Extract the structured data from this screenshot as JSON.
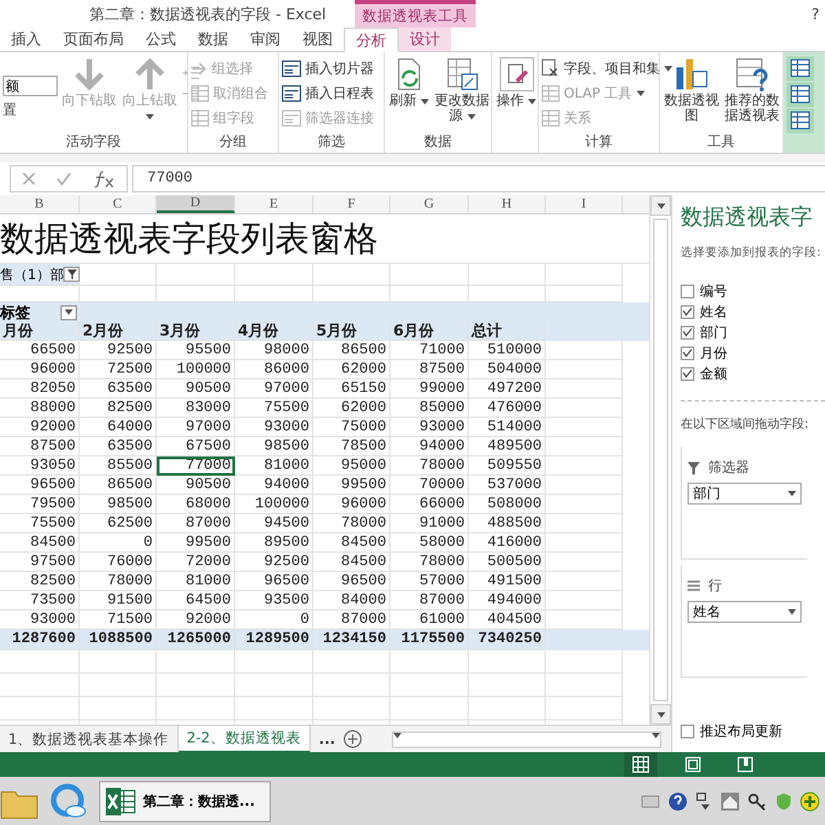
{
  "title_bar": {
    "title": "第二章：数据透视表的字段 - Excel",
    "context_tab": "数据透视表工具",
    "help": "?"
  },
  "tabs": [
    {
      "label": "插入",
      "selected": false,
      "contextual": false
    },
    {
      "label": "页面布局",
      "selected": false,
      "contextual": false
    },
    {
      "label": "公式",
      "selected": false,
      "contextual": false
    },
    {
      "label": "数据",
      "selected": false,
      "contextual": false
    },
    {
      "label": "审阅",
      "selected": false,
      "contextual": false
    },
    {
      "label": "视图",
      "selected": false,
      "contextual": false
    },
    {
      "label": "分析",
      "selected": true,
      "contextual": true
    },
    {
      "label": "设计",
      "selected": false,
      "contextual": true
    }
  ],
  "ribbon": {
    "groups": [
      {
        "label": "活动字段",
        "items": [
          {
            "kind": "field",
            "value": "额"
          },
          {
            "kind": "text",
            "label": "置"
          },
          {
            "kind": "large",
            "label": "向下钻取",
            "disabled": true,
            "dropdown": false
          },
          {
            "kind": "large",
            "label": "向上钻取",
            "disabled": true,
            "dropdown": true
          },
          {
            "kind": "iconpair",
            "disabled": true
          }
        ]
      },
      {
        "label": "分组",
        "items": [
          {
            "kind": "small",
            "label": "组选择",
            "disabled": true,
            "dropdown": false
          },
          {
            "kind": "small",
            "label": "取消组合",
            "disabled": true,
            "dropdown": false
          },
          {
            "kind": "small",
            "label": "组字段",
            "disabled": true,
            "dropdown": false
          }
        ]
      },
      {
        "label": "筛选",
        "items": [
          {
            "kind": "small",
            "label": "插入切片器",
            "disabled": false,
            "dropdown": false
          },
          {
            "kind": "small",
            "label": "插入日程表",
            "disabled": false,
            "dropdown": false
          },
          {
            "kind": "small",
            "label": "筛选器连接",
            "disabled": true,
            "dropdown": false
          }
        ]
      },
      {
        "label": "数据",
        "items": [
          {
            "kind": "large",
            "label": "刷新",
            "disabled": false,
            "dropdown": true
          },
          {
            "kind": "large",
            "label": "更改数据源",
            "disabled": false,
            "dropdown": true
          }
        ]
      },
      {
        "items": [
          {
            "kind": "large",
            "label": "操作",
            "disabled": false,
            "dropdown": true
          }
        ]
      },
      {
        "label": "计算",
        "items": [
          {
            "kind": "small",
            "label": "字段、项目和集",
            "disabled": false,
            "dropdown": true
          },
          {
            "kind": "small",
            "label": "OLAP 工具",
            "disabled": true,
            "dropdown": true
          },
          {
            "kind": "small",
            "label": "关系",
            "disabled": true,
            "dropdown": false
          }
        ]
      },
      {
        "label": "工具",
        "items": [
          {
            "kind": "large",
            "label": "数据透视图",
            "disabled": false,
            "dropdown": false
          },
          {
            "kind": "large",
            "label": "推荐的数据透视表",
            "disabled": false,
            "dropdown": false
          }
        ]
      },
      {
        "items": [
          {
            "kind": "toggle",
            "on": true
          },
          {
            "kind": "toggle",
            "on": true
          },
          {
            "kind": "toggle",
            "on": true
          }
        ]
      }
    ]
  },
  "formula_bar": {
    "value": "77000"
  },
  "columns": [
    {
      "label": "B",
      "selected": false
    },
    {
      "label": "C",
      "selected": false
    },
    {
      "label": "D",
      "selected": true
    },
    {
      "label": "E",
      "selected": false
    },
    {
      "label": "F",
      "selected": false
    },
    {
      "label": "G",
      "selected": false
    },
    {
      "label": "H",
      "selected": false
    },
    {
      "label": "I",
      "selected": false
    }
  ],
  "sheet": {
    "title": "数据透视表字段列表窗格",
    "filter": "售（1）部",
    "column_label": "标签",
    "header": [
      "月份",
      "2月份",
      "3月份",
      "4月份",
      "5月份",
      "6月份",
      "总计"
    ],
    "rows": [
      [
        {
          "v": "66500",
          "selected": false
        },
        {
          "v": "92500",
          "selected": false
        },
        {
          "v": "95500",
          "selected": false
        },
        {
          "v": "98000",
          "selected": false
        },
        {
          "v": "86500",
          "selected": false
        },
        {
          "v": "71000",
          "selected": false
        },
        {
          "v": "510000",
          "selected": false
        }
      ],
      [
        {
          "v": "96000",
          "selected": false
        },
        {
          "v": "72500",
          "selected": false
        },
        {
          "v": "100000",
          "selected": false
        },
        {
          "v": "86000",
          "selected": false
        },
        {
          "v": "62000",
          "selected": false
        },
        {
          "v": "87500",
          "selected": false
        },
        {
          "v": "504000",
          "selected": false
        }
      ],
      [
        {
          "v": "82050",
          "selected": false
        },
        {
          "v": "63500",
          "selected": false
        },
        {
          "v": "90500",
          "selected": false
        },
        {
          "v": "97000",
          "selected": false
        },
        {
          "v": "65150",
          "selected": false
        },
        {
          "v": "99000",
          "selected": false
        },
        {
          "v": "497200",
          "selected": false
        }
      ],
      [
        {
          "v": "88000",
          "selected": false
        },
        {
          "v": "82500",
          "selected": false
        },
        {
          "v": "83000",
          "selected": false
        },
        {
          "v": "75500",
          "selected": false
        },
        {
          "v": "62000",
          "selected": false
        },
        {
          "v": "85000",
          "selected": false
        },
        {
          "v": "476000",
          "selected": false
        }
      ],
      [
        {
          "v": "92000",
          "selected": false
        },
        {
          "v": "64000",
          "selected": false
        },
        {
          "v": "97000",
          "selected": false
        },
        {
          "v": "93000",
          "selected": false
        },
        {
          "v": "75000",
          "selected": false
        },
        {
          "v": "93000",
          "selected": false
        },
        {
          "v": "514000",
          "selected": false
        }
      ],
      [
        {
          "v": "87500",
          "selected": false
        },
        {
          "v": "63500",
          "selected": false
        },
        {
          "v": "67500",
          "selected": false
        },
        {
          "v": "98500",
          "selected": false
        },
        {
          "v": "78500",
          "selected": false
        },
        {
          "v": "94000",
          "selected": false
        },
        {
          "v": "489500",
          "selected": false
        }
      ],
      [
        {
          "v": "93050",
          "selected": false
        },
        {
          "v": "85500",
          "selected": false
        },
        {
          "v": "77000",
          "selected": true
        },
        {
          "v": "81000",
          "selected": false
        },
        {
          "v": "95000",
          "selected": false
        },
        {
          "v": "78000",
          "selected": false
        },
        {
          "v": "509550",
          "selected": false
        }
      ],
      [
        {
          "v": "96500",
          "selected": false
        },
        {
          "v": "86500",
          "selected": false
        },
        {
          "v": "90500",
          "selected": false
        },
        {
          "v": "94000",
          "selected": false
        },
        {
          "v": "99500",
          "selected": false
        },
        {
          "v": "70000",
          "selected": false
        },
        {
          "v": "537000",
          "selected": false
        }
      ],
      [
        {
          "v": "79500",
          "selected": false
        },
        {
          "v": "98500",
          "selected": false
        },
        {
          "v": "68000",
          "selected": false
        },
        {
          "v": "100000",
          "selected": false
        },
        {
          "v": "96000",
          "selected": false
        },
        {
          "v": "66000",
          "selected": false
        },
        {
          "v": "508000",
          "selected": false
        }
      ],
      [
        {
          "v": "75500",
          "selected": false
        },
        {
          "v": "62500",
          "selected": false
        },
        {
          "v": "87000",
          "selected": false
        },
        {
          "v": "94500",
          "selected": false
        },
        {
          "v": "78000",
          "selected": false
        },
        {
          "v": "91000",
          "selected": false
        },
        {
          "v": "488500",
          "selected": false
        }
      ],
      [
        {
          "v": "84500",
          "selected": false
        },
        {
          "v": "0",
          "selected": false
        },
        {
          "v": "99500",
          "selected": false
        },
        {
          "v": "89500",
          "selected": false
        },
        {
          "v": "84500",
          "selected": false
        },
        {
          "v": "58000",
          "selected": false
        },
        {
          "v": "416000",
          "selected": false
        }
      ],
      [
        {
          "v": "97500",
          "selected": false
        },
        {
          "v": "76000",
          "selected": false
        },
        {
          "v": "72000",
          "selected": false
        },
        {
          "v": "92500",
          "selected": false
        },
        {
          "v": "84500",
          "selected": false
        },
        {
          "v": "78000",
          "selected": false
        },
        {
          "v": "500500",
          "selected": false
        }
      ],
      [
        {
          "v": "82500",
          "selected": false
        },
        {
          "v": "78000",
          "selected": false
        },
        {
          "v": "81000",
          "selected": false
        },
        {
          "v": "96500",
          "selected": false
        },
        {
          "v": "96500",
          "selected": false
        },
        {
          "v": "57000",
          "selected": false
        },
        {
          "v": "491500",
          "selected": false
        }
      ],
      [
        {
          "v": "73500",
          "selected": false
        },
        {
          "v": "91500",
          "selected": false
        },
        {
          "v": "64500",
          "selected": false
        },
        {
          "v": "93500",
          "selected": false
        },
        {
          "v": "84000",
          "selected": false
        },
        {
          "v": "87000",
          "selected": false
        },
        {
          "v": "494000",
          "selected": false
        }
      ],
      [
        {
          "v": "93000",
          "selected": false
        },
        {
          "v": "71500",
          "selected": false
        },
        {
          "v": "92000",
          "selected": false
        },
        {
          "v": "0",
          "selected": false
        },
        {
          "v": "87000",
          "selected": false
        },
        {
          "v": "61000",
          "selected": false
        },
        {
          "v": "404500",
          "selected": false
        }
      ]
    ],
    "total": [
      "1287600",
      "1088500",
      "1265000",
      "1289500",
      "1234150",
      "1175500",
      "7340250"
    ]
  },
  "sheet_tabs": [
    {
      "label": "1、数据透视表基本操作",
      "selected": false
    },
    {
      "label": "2-2、数据透视表",
      "selected": true
    }
  ],
  "more_sheets": "...",
  "field_pane": {
    "title": "数据透视表字",
    "subtitle": "选择要添加到报表的字段:",
    "fields": [
      {
        "label": "编号",
        "checked": false
      },
      {
        "label": "姓名",
        "checked": true
      },
      {
        "label": "部门",
        "checked": true
      },
      {
        "label": "月份",
        "checked": true
      },
      {
        "label": "金额",
        "checked": true
      }
    ],
    "drag_label": "在以下区域间拖动字段:",
    "areas": [
      {
        "kind": "filter",
        "label": "筛选器",
        "field": "部门"
      },
      {
        "kind": "rows",
        "label": "行",
        "field": "姓名"
      }
    ],
    "defer": {
      "label": "推迟布局更新",
      "checked": false
    }
  },
  "taskbar": {
    "task": "第二章：数据透..."
  }
}
